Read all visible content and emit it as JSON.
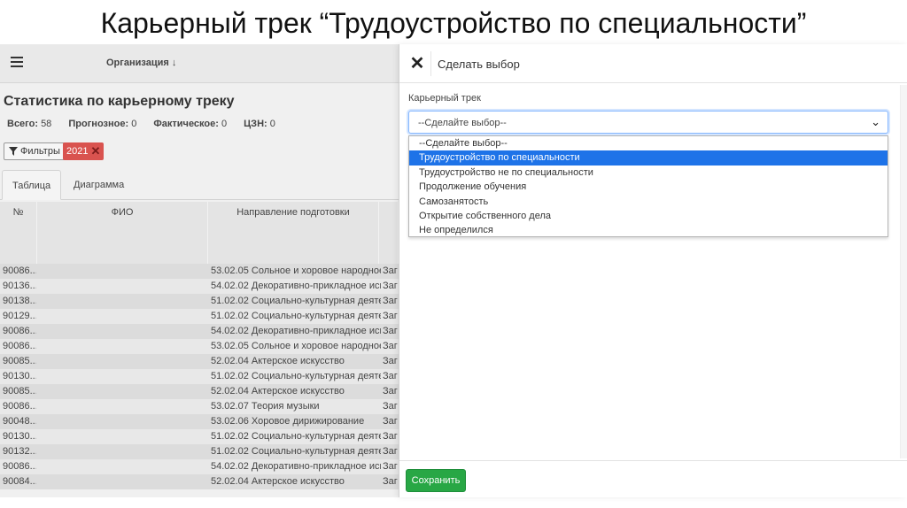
{
  "slide": {
    "title": "Карьерный трек “Трудоустройство по специальности”"
  },
  "app": {
    "header": {
      "org_menu": "Организация ↓"
    },
    "page_title": "Статистика по карьерному треку",
    "stats": {
      "total_label": "Всего:",
      "total_value": "58",
      "forecast_label": "Прогнозное:",
      "forecast_value": "0",
      "actual_label": "Фактическое:",
      "actual_value": "0",
      "czn_label": "ЦЗН:",
      "czn_value": "0"
    },
    "filters_label": "Фильтры",
    "year_badge": "2021",
    "tabs": [
      "Таблица",
      "Диаграмма"
    ],
    "table": {
      "headers": [
        "№",
        "ФИО",
        "Направление подготовки",
        ""
      ],
      "rows": [
        {
          "num": "90086...",
          "direction": "53.02.05 Сольное и хоровое народное...",
          "extra": "Заг"
        },
        {
          "num": "90136...",
          "direction": "54.02.02 Декоративно-прикладное иск...",
          "extra": "Заг"
        },
        {
          "num": "90138...",
          "direction": "51.02.02 Социально-культурная деятел...",
          "extra": "Заг"
        },
        {
          "num": "90129...",
          "direction": "51.02.02 Социально-культурная деятел...",
          "extra": "Заг"
        },
        {
          "num": "90086...",
          "direction": "54.02.02 Декоративно-прикладное иск...",
          "extra": "Заг"
        },
        {
          "num": "90086...",
          "direction": "53.02.05 Сольное и хоровое народное...",
          "extra": "Заг"
        },
        {
          "num": "90085...",
          "direction": "52.02.04 Актерское искусство",
          "extra": "Заг"
        },
        {
          "num": "90130...",
          "direction": "51.02.02 Социально-культурная деятел...",
          "extra": "Заг"
        },
        {
          "num": "90085...",
          "direction": "52.02.04 Актерское искусство",
          "extra": "Заг"
        },
        {
          "num": "90086...",
          "direction": "53.02.07 Теория музыки",
          "extra": "Заг"
        },
        {
          "num": "90048...",
          "direction": "53.02.06 Хоровое дирижирование",
          "extra": "Заг"
        },
        {
          "num": "90130...",
          "direction": "51.02.02 Социально-культурная деятел...",
          "extra": "Заг"
        },
        {
          "num": "90132...",
          "direction": "51.02.02 Социально-культурная деятел...",
          "extra": "Заг"
        },
        {
          "num": "90086...",
          "direction": "54.02.02 Декоративно-прикладное иск...",
          "extra": "Заг"
        },
        {
          "num": "90084...",
          "direction": "52.02.04 Актерское искусство",
          "extra": "Заг"
        }
      ]
    }
  },
  "dialog": {
    "close_icon": "close-icon",
    "title": "Сделать выбор",
    "field_label": "Карьерный трек",
    "select_value": "--Сделайте выбор--",
    "options": [
      "--Сделайте выбор--",
      "Трудоустройство по специальности",
      "Трудоустройство не по специальности",
      "Продолжение обучения",
      "Самозанятость",
      "Открытие собственного дела",
      "Не определился"
    ],
    "highlighted_option": "Трудоустройство по специальности",
    "save_label": "Сохранить",
    "colors": {
      "save": "#28a745",
      "highlight": "#1e73e8",
      "badge": "#d9534f"
    }
  }
}
